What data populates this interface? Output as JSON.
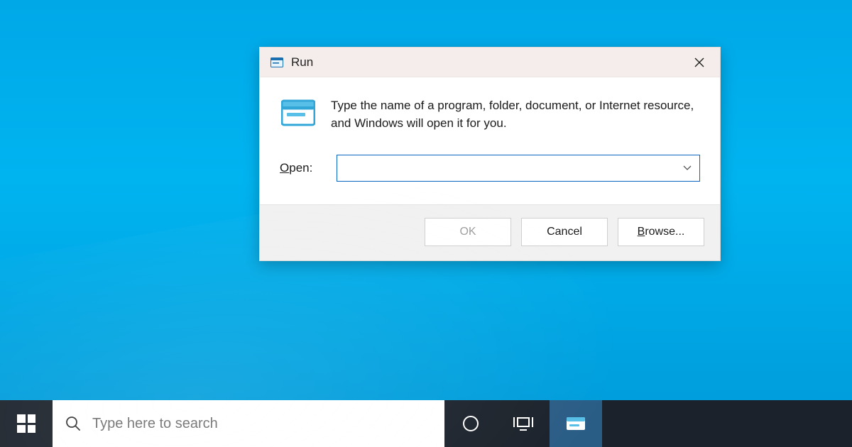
{
  "dialog": {
    "title": "Run",
    "description": "Type the name of a program, folder, document, or Internet resource, and Windows will open it for you.",
    "open_label_prefix": "O",
    "open_label_rest": "pen:",
    "input_value": "",
    "buttons": {
      "ok": "OK",
      "cancel": "Cancel",
      "browse_prefix": "B",
      "browse_rest": "rowse..."
    }
  },
  "taskbar": {
    "search_placeholder": "Type here to search"
  }
}
